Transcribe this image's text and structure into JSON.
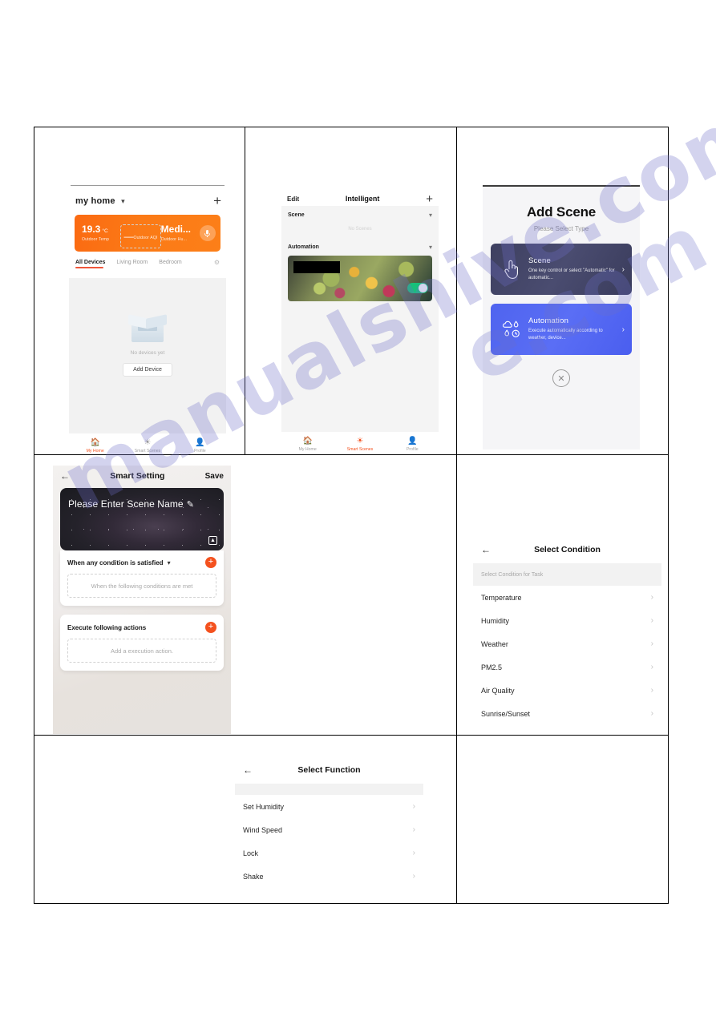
{
  "watermark": {
    "line1": "manualshive.com",
    "line2": "e.com"
  },
  "panel_my_home": {
    "home_name": "my home",
    "chevron_icon": "chevron-down-icon",
    "add_icon": "plus-icon",
    "weather": {
      "temp_value": "19.3",
      "temp_unit": "°C",
      "temp_label": "Outdoor Temp",
      "aqi_value": "—",
      "aqi_label": "Outdoor AQI",
      "hum_value": "Medi...",
      "hum_label": "Outdoor Hu...",
      "mic_icon": "microphone-icon"
    },
    "tabs": [
      {
        "label": "All Devices",
        "active": true
      },
      {
        "label": "Living Room",
        "active": false
      },
      {
        "label": "Bedroom",
        "active": false
      }
    ],
    "settings_icon": "gear-icon",
    "empty_text": "No devices yet",
    "add_device_label": "Add Device",
    "nav": [
      {
        "label": "My Home",
        "icon": "home-icon",
        "active": true
      },
      {
        "label": "Smart Scenes",
        "icon": "sun-icon",
        "active": false
      },
      {
        "label": "Profile",
        "icon": "person-icon",
        "active": false
      }
    ]
  },
  "panel_intelligent": {
    "edit_label": "Edit",
    "title": "Intelligent",
    "add_icon": "plus-icon",
    "scene_section": {
      "label": "Scene",
      "chevron": "chevron-down-icon",
      "empty_text": "No Scenes"
    },
    "automation_section": {
      "label": "Automation",
      "chevron": "chevron-down-icon"
    },
    "nav": [
      {
        "label": "My Home",
        "icon": "home-icon",
        "active": false
      },
      {
        "label": "Smart Scenes",
        "icon": "sun-icon",
        "active": true
      },
      {
        "label": "Profile",
        "icon": "person-icon",
        "active": false
      }
    ]
  },
  "panel_add_scene": {
    "title": "Add Scene",
    "subtitle": "Please Select Type",
    "options": [
      {
        "title": "Scene",
        "desc": "One key control or select \"Automatic\" for automatic...",
        "icon": "tap-hand-icon",
        "arrow": "chevron-right-icon"
      },
      {
        "title": "Automation",
        "desc": "Execute automatically according to weather, device...",
        "icon": "weather-drops-icon",
        "arrow": "chevron-right-icon"
      }
    ],
    "close_icon": "close-circle-icon"
  },
  "panel_smart_setting": {
    "back_icon": "arrow-left-icon",
    "title": "Smart Setting",
    "save_label": "Save",
    "scene_name_placeholder": "Please Enter Scene Name",
    "edit_icon": "pencil-icon",
    "image_icon": "image-picker-icon",
    "condition_block": {
      "label": "When any condition is satisfied",
      "chevron": "chevron-down-icon",
      "add_icon": "plus-circle-icon",
      "placeholder": "When the following conditions are met"
    },
    "action_block": {
      "label": "Execute following actions",
      "add_icon": "plus-circle-icon",
      "placeholder": "Add a execution action."
    }
  },
  "panel_select_condition": {
    "back_icon": "arrow-left-icon",
    "title": "Select Condition",
    "section_label": "Select Condition for Task",
    "items": [
      {
        "label": "Temperature",
        "arrow": "chevron-right-icon"
      },
      {
        "label": "Humidity",
        "arrow": "chevron-right-icon"
      },
      {
        "label": "Weather",
        "arrow": "chevron-right-icon"
      },
      {
        "label": "PM2.5",
        "arrow": "chevron-right-icon"
      },
      {
        "label": "Air Quality",
        "arrow": "chevron-right-icon"
      },
      {
        "label": "Sunrise/Sunset",
        "arrow": "chevron-right-icon"
      }
    ]
  },
  "panel_select_function": {
    "back_icon": "arrow-left-icon",
    "title": "Select Function",
    "items": [
      {
        "label": "Set Humidity",
        "arrow": "chevron-right-icon"
      },
      {
        "label": "Wind Speed",
        "arrow": "chevron-right-icon"
      },
      {
        "label": "Lock",
        "arrow": "chevron-right-icon"
      },
      {
        "label": "Shake",
        "arrow": "chevron-right-icon"
      }
    ]
  },
  "colors": {
    "accent_orange": "#f4511e",
    "weather_card": "#fb7a16",
    "scene_card": "#454768",
    "automation_card": "#5264f0",
    "toggle_on": "#18c07a",
    "watermark": "#6c6ec8"
  }
}
